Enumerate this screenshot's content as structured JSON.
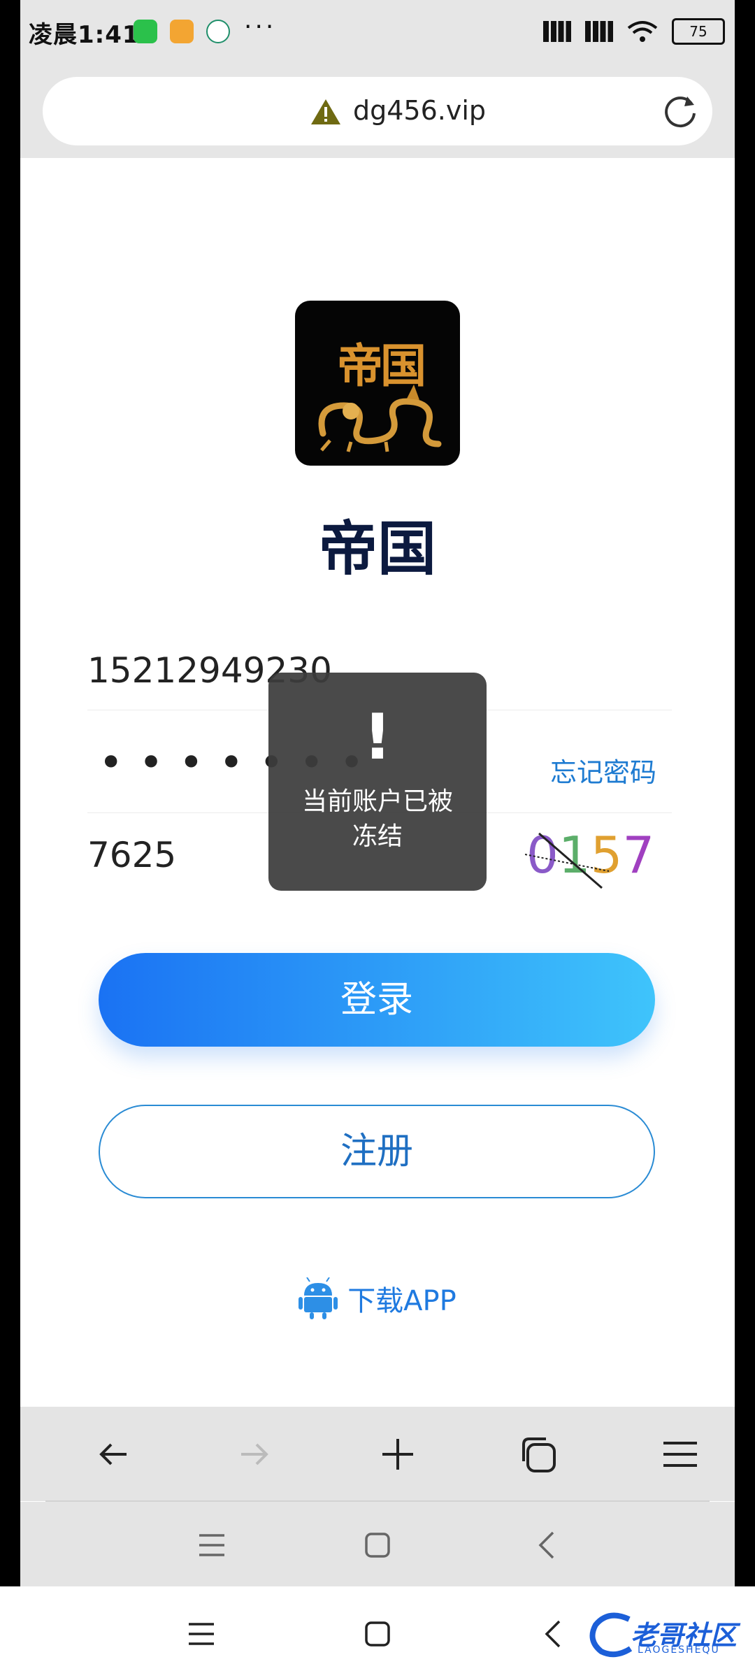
{
  "status": {
    "time": "凌晨1:41",
    "battery": "75"
  },
  "browser": {
    "url": "dg456.vip"
  },
  "app": {
    "logo_text": "帝国",
    "title": "帝国"
  },
  "form": {
    "phone_value": "15212949230",
    "password_mask": "•••••••",
    "forgot_label": "忘记密码",
    "code_value": "7625",
    "captcha_text": "0157"
  },
  "toast": {
    "mark": "!",
    "message": "当前账户已被冻结"
  },
  "buttons": {
    "login_label": "登录",
    "register_label": "注册",
    "download_label": "下载APP"
  },
  "watermark": {
    "text": "老哥社区",
    "sub": "LAOGESHEQU"
  },
  "colors": {
    "accent": "#1e7bd1",
    "login_gradient_start": "#1a72f3",
    "login_gradient_end": "#3fc4fb",
    "title": "#0c1a3f"
  }
}
